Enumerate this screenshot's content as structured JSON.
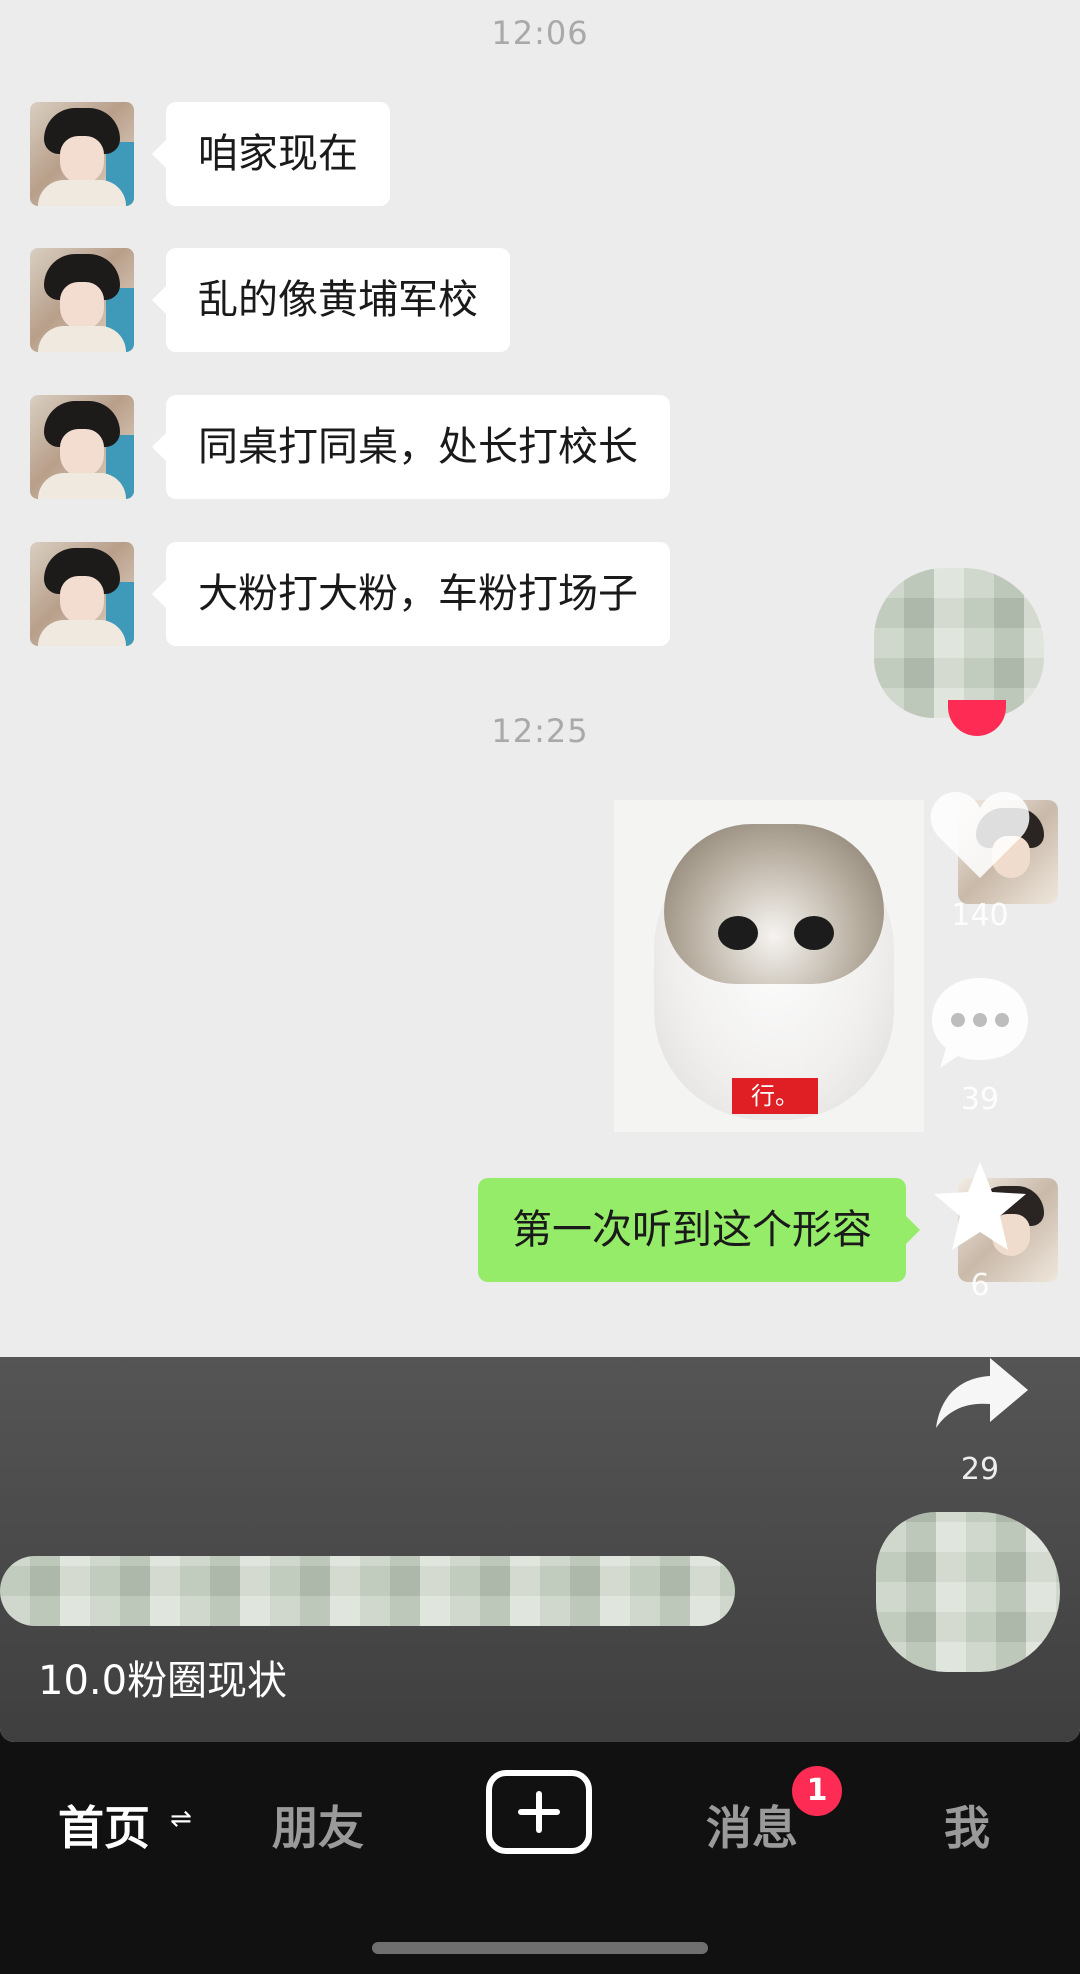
{
  "chat": {
    "time_1": "12:06",
    "messages_left": [
      "咱家现在",
      "乱的像黄埔军校",
      "同桌打同桌，处长打校长",
      "大粉打大粉，车粉打场子"
    ],
    "time_2": "12:25",
    "sticker_text": "行。",
    "message_right": "第一次听到这个形容"
  },
  "video": {
    "caption": "10.0粉圈现状",
    "like_count": "140",
    "comment_count": "39",
    "favorite_count": "6",
    "share_count": "29"
  },
  "nav": {
    "home": "首页",
    "friends": "朋友",
    "messages": "消息",
    "messages_badge": "1",
    "me": "我"
  },
  "colors": {
    "bubble_right": "#95ec69",
    "badge": "#fe2c55"
  },
  "icons": [
    "heart-icon",
    "comment-icon",
    "star-icon",
    "share-icon",
    "plus-icon",
    "swap-icon"
  ]
}
